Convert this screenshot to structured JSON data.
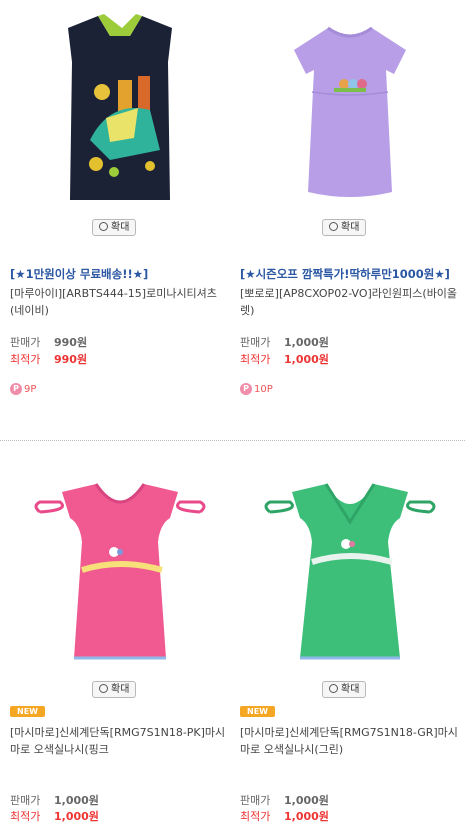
{
  "zoom_label": "확대",
  "products": [
    {
      "promo": "[★1만원이상 무료배송!!★]",
      "name": "[마루아이l][ARBTS444-15]로미나시티셔츠(네이비)",
      "price_label": "판매가",
      "price": "990원",
      "best_label": "최적가",
      "best_price": "990원",
      "points": "9P",
      "image": "navy-sleeveless-tee"
    },
    {
      "promo": "[★시즌오프 깜짝특가!딱하루만1000원★]",
      "name": "[뽀로로][AP8CXOP02-VO]라인원피스(바이올렛)",
      "price_label": "판매가",
      "price": "1,000원",
      "best_label": "최적가",
      "best_price": "1,000원",
      "points": "10P",
      "image": "violet-dress-tee"
    },
    {
      "badge": "NEW",
      "name": "[마시마로]신세계단독[RMG7S1N18-PK]마시마로 오색실나시(핑크",
      "price_label": "판매가",
      "price": "1,000원",
      "best_label": "최적가",
      "best_price": "1,000원",
      "image": "pink-sleeveless-top"
    },
    {
      "badge": "NEW",
      "name": "[마시마로]신세계단독[RMG7S1N18-GR]마시마로 오색실나시(그린)",
      "price_label": "판매가",
      "price": "1,000원",
      "best_label": "최적가",
      "best_price": "1,000원",
      "image": "green-sleeveless-top"
    }
  ]
}
